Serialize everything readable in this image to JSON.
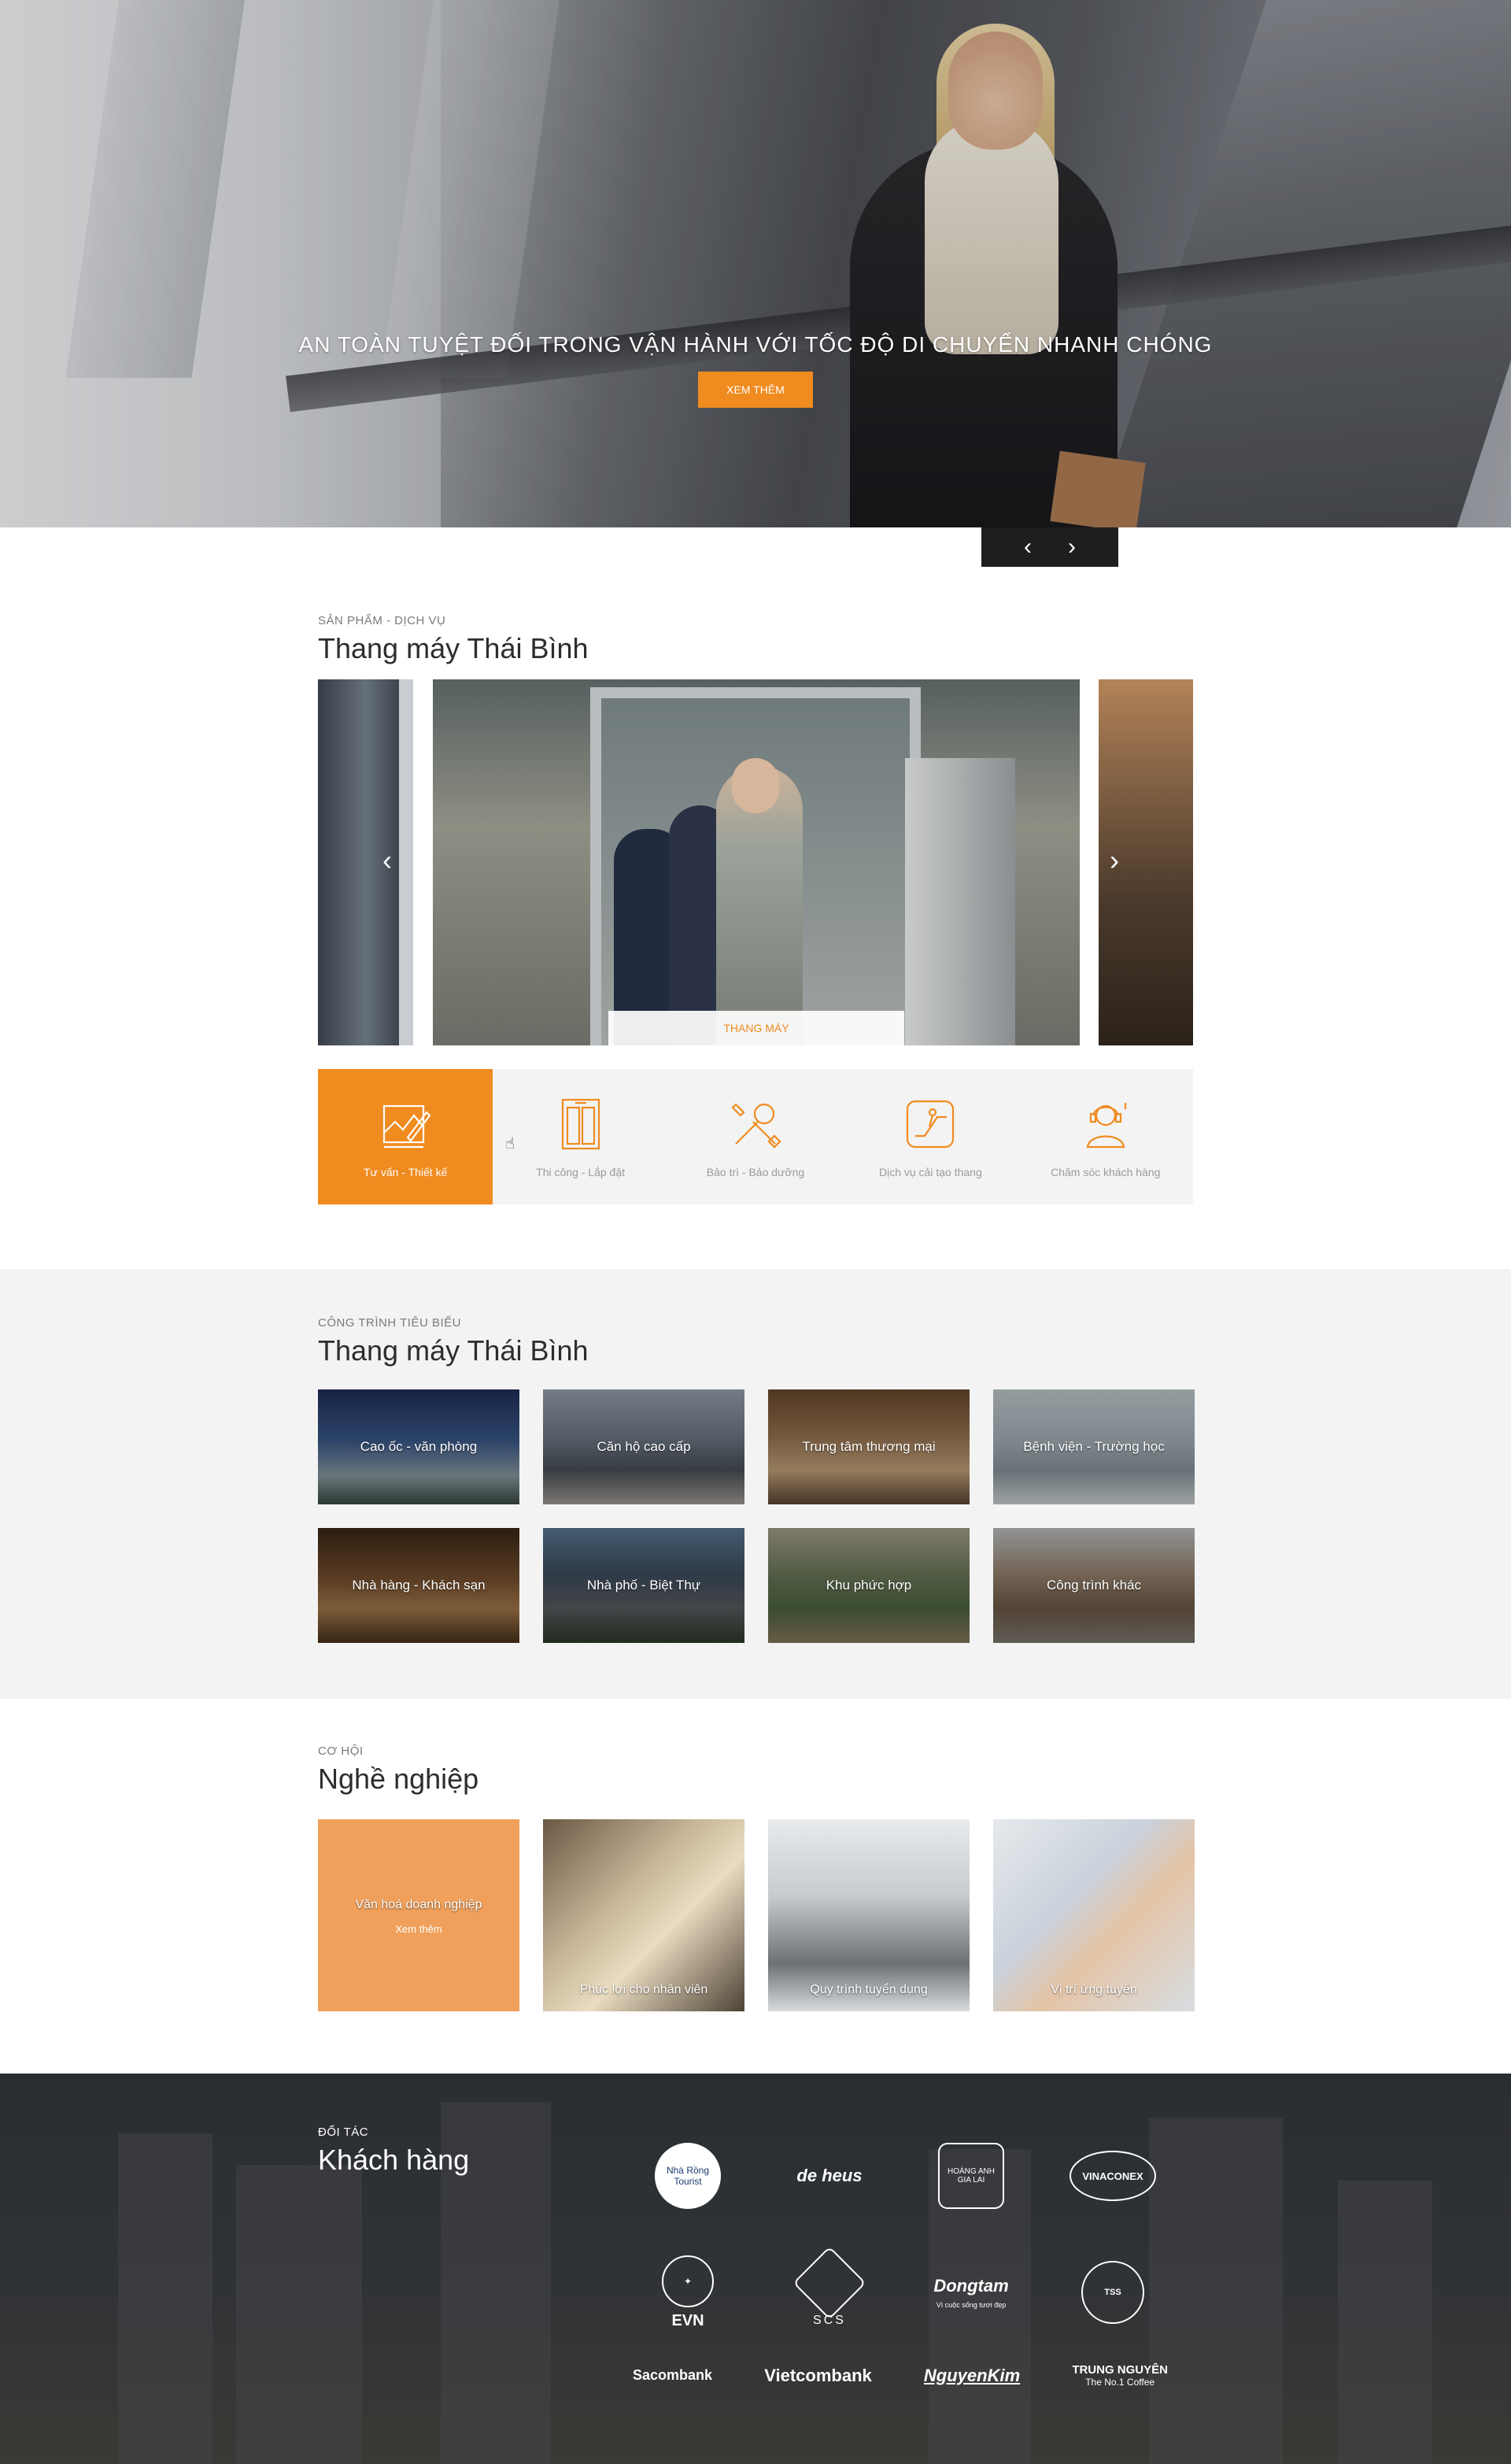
{
  "hero": {
    "title": "AN TOÀN TUYỆT ĐỐI TRONG VẬN HÀNH VỚI TỐC ĐỘ DI CHUYỂN NHANH CHÓNG",
    "button": "XEM THÊM",
    "prev_glyph": "‹",
    "next_glyph": "›"
  },
  "products": {
    "kicker": "SẢN PHẨM - DỊCH VỤ",
    "title": "Thang máy Thái Bình",
    "slide_label": "THANG MÁY",
    "prev_glyph": "‹",
    "next_glyph": "›",
    "services": [
      {
        "label": "Tư vấn - Thiết kế",
        "icon": "design-icon",
        "active": true
      },
      {
        "label": "Thi công - Lắp đặt",
        "icon": "elevator-door-icon",
        "active": false
      },
      {
        "label": "Bảo trì - Bảo dưỡng",
        "icon": "tools-icon",
        "active": false
      },
      {
        "label": "Dịch vụ cải tạo thang",
        "icon": "escalator-icon",
        "active": false
      },
      {
        "label": "Chăm sóc khách hàng",
        "icon": "support-agent-icon",
        "active": false
      }
    ]
  },
  "projects": {
    "kicker": "CÔNG TRÌNH TIÊU BIỂU",
    "title": "Thang máy Thái Bình",
    "items": [
      {
        "label": "Cao ốc - văn phòng"
      },
      {
        "label": "Căn hộ cao cấp"
      },
      {
        "label": "Trung tâm thương mại"
      },
      {
        "label": "Bệnh viện - Trường học"
      },
      {
        "label": "Nhà hàng - Khách sạn"
      },
      {
        "label": "Nhà phố - Biệt Thự"
      },
      {
        "label": "Khu phức hợp"
      },
      {
        "label": "Công trình khác"
      }
    ]
  },
  "careers": {
    "kicker": "CƠ HỘI",
    "title": "Nghề nghiệp",
    "items": [
      {
        "label": "Văn hoá doanh nghiệp",
        "more": "Xem thêm"
      },
      {
        "label": "Phúc lợi cho nhân viên"
      },
      {
        "label": "Quy trình tuyển dụng"
      },
      {
        "label": "Vị trí ứng tuyển"
      }
    ]
  },
  "partners": {
    "kicker": "ĐỐI TÁC",
    "title": "Khách hàng",
    "logos_row1": [
      {
        "name": "Nhà Rồng Tourist"
      },
      {
        "name": "de heus"
      },
      {
        "name": "HOÀNG ANH GIA LAI"
      },
      {
        "name": "VINACONEX"
      }
    ],
    "logos_row2": [
      {
        "name": "EVN"
      },
      {
        "name": "SCS"
      },
      {
        "name": "Dongtam",
        "tagline": "Vì cuộc sống tươi đẹp"
      },
      {
        "name": "TSS"
      }
    ],
    "banks": [
      {
        "name": "Sacombank"
      },
      {
        "name": "Vietcombank"
      },
      {
        "name": "NguyenKim"
      },
      {
        "name": "TRUNG NGUYÊN",
        "tagline": "The No.1 Coffee"
      }
    ]
  },
  "colors": {
    "accent": "#f08b1f",
    "light_gray": "#f3f3f3",
    "dark": "#1e1e1e"
  }
}
